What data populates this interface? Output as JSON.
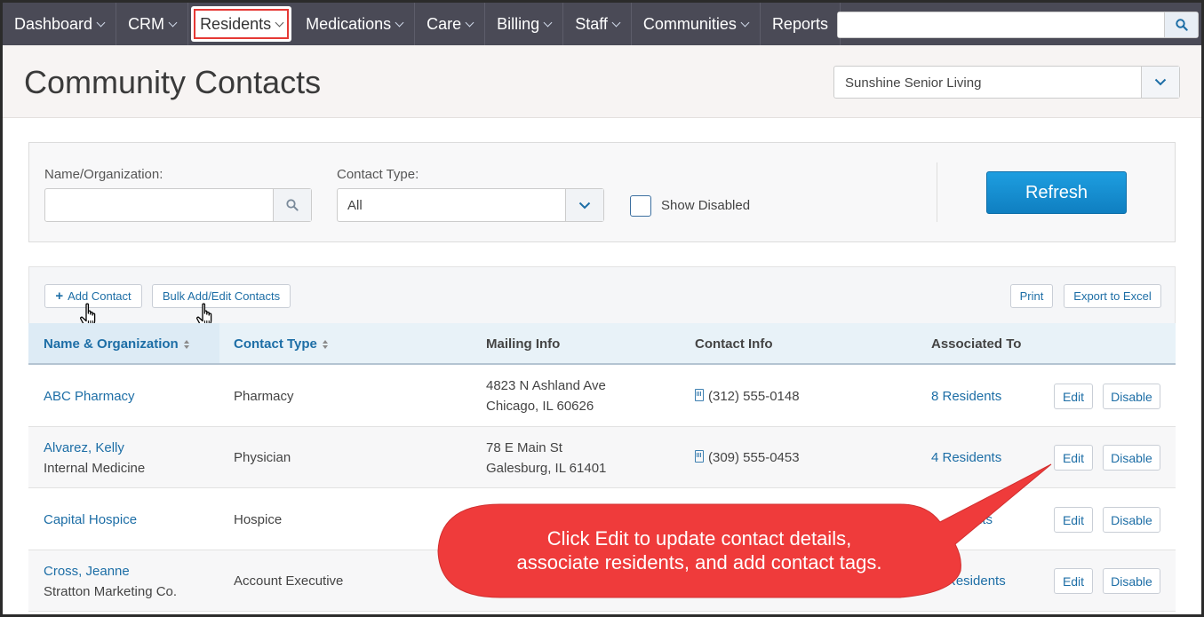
{
  "nav": {
    "items": [
      {
        "label": "Dashboard",
        "chevron": true
      },
      {
        "label": "CRM",
        "chevron": true
      },
      {
        "label": "Residents",
        "chevron": true,
        "highlighted": true
      },
      {
        "label": "Medications",
        "chevron": true
      },
      {
        "label": "Care",
        "chevron": true
      },
      {
        "label": "Billing",
        "chevron": true
      },
      {
        "label": "Staff",
        "chevron": true
      },
      {
        "label": "Communities",
        "chevron": true
      },
      {
        "label": "Reports",
        "chevron": false
      }
    ],
    "search_placeholder": ""
  },
  "header": {
    "title": "Community Contacts",
    "community": "Sunshine Senior Living"
  },
  "filters": {
    "name_label": "Name/Organization:",
    "name_value": "",
    "type_label": "Contact Type:",
    "type_value": "All",
    "show_disabled_label": "Show Disabled",
    "show_disabled_checked": false,
    "refresh_label": "Refresh"
  },
  "toolbar": {
    "add_contact": "Add Contact",
    "bulk_edit": "Bulk Add/Edit Contacts",
    "print": "Print",
    "export": "Export to Excel"
  },
  "table": {
    "headers": {
      "name": "Name & Organization",
      "type": "Contact Type",
      "mailing": "Mailing Info",
      "contact": "Contact Info",
      "associated": "Associated To"
    },
    "edit_label": "Edit",
    "disable_label": "Disable",
    "rows": [
      {
        "name": "ABC Pharmacy",
        "org": "",
        "type": "Pharmacy",
        "addr1": "4823 N Ashland Ave",
        "addr2": "Chicago, IL 60626",
        "phone": "(312) 555-0148",
        "associated": "8 Residents"
      },
      {
        "name": "Alvarez, Kelly",
        "org": "Internal Medicine",
        "type": "Physician",
        "addr1": "78 E Main St",
        "addr2": "Galesburg, IL 61401",
        "phone": "(309) 555-0453",
        "associated": "4 Residents"
      },
      {
        "name": "Capital Hospice",
        "org": "",
        "type": "Hospice",
        "addr1": "",
        "addr2": "",
        "phone": "",
        "associated": "nts"
      },
      {
        "name": "Cross, Jeanne",
        "org": "Stratton Marketing Co.",
        "type": "Account Executive",
        "addr1": "",
        "addr2": "",
        "phone": "",
        "associated": "Residents"
      }
    ]
  },
  "callout": {
    "line1": "Click Edit to update contact details,",
    "line2": "associate residents, and add contact tags.",
    "color": "#ef3b3b"
  }
}
